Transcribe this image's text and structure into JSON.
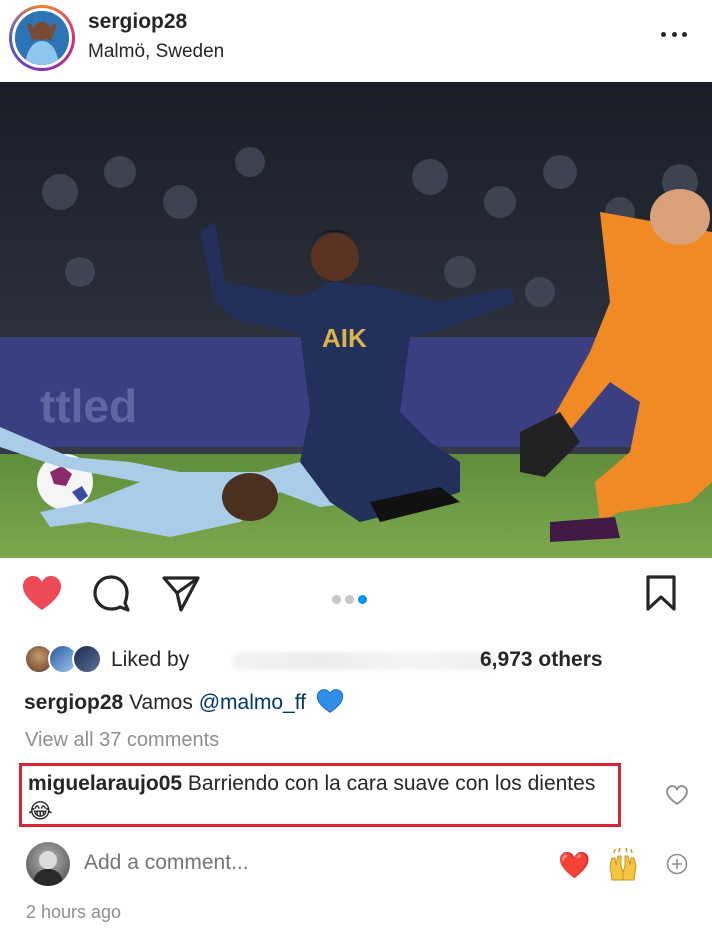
{
  "post": {
    "username": "sergiop28",
    "location": "Malmö, Sweden",
    "more_icon": "more-horizontal-icon",
    "photo_alt": "Football action photo",
    "jersey_text": "AIK"
  },
  "actions": {
    "like_icon": "heart-filled-icon",
    "comment_icon": "comment-bubble-icon",
    "share_icon": "paper-plane-icon",
    "save_icon": "bookmark-icon",
    "carousel_total": 3,
    "carousel_active": 3,
    "accent_color": "#0095f6",
    "like_color": "#ed4956"
  },
  "likes": {
    "liked_by_label": "Liked by",
    "others_label": "6,973 others"
  },
  "caption": {
    "username": "sergiop28",
    "text": "Vamos",
    "mention": "@malmo_ff",
    "emoji_icon": "blue-heart-icon"
  },
  "view_all": "View all 37 comments",
  "comment": {
    "username": "miguelaraujo05",
    "text": "Barriendo con la cara suave con los dientes",
    "emoji": "😂",
    "highlight_color": "#d92535"
  },
  "add_comment": {
    "placeholder": "Add a comment...",
    "quick_reactions": [
      "❤️",
      "🙌"
    ]
  },
  "timestamp": "2 hours ago"
}
